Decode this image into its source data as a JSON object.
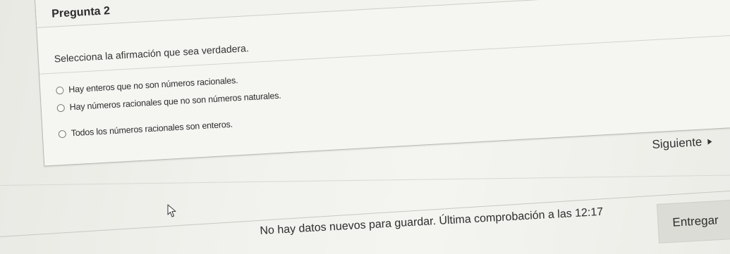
{
  "question": {
    "title": "Pregunta 2",
    "prompt": "Selecciona la afirmación que sea verdadera.",
    "options": [
      {
        "label": "Hay enteros que no son números racionales.",
        "selected": false
      },
      {
        "label": "Hay números racionales que no son números naturales.",
        "selected": false
      },
      {
        "label": "Todos los números racionales son enteros.",
        "selected": false
      }
    ]
  },
  "navigation": {
    "next_label": "Siguiente",
    "next_icon": "triangle-right-icon"
  },
  "footer": {
    "status_text": "No hay datos nuevos para guardar. Última comprobación a las 12:17",
    "submit_label": "Entregar"
  },
  "cursor": {
    "icon": "mouse-pointer-icon"
  }
}
